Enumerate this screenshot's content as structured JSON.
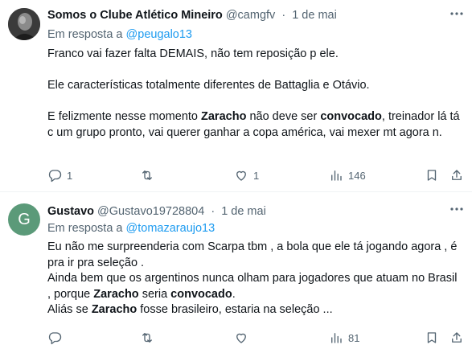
{
  "tweets": [
    {
      "author_name": "Somos o Clube Atlético Mineiro",
      "handle": "@camgfv",
      "separator": "·",
      "date": "1 de mai",
      "reply_prefix": "Em resposta a",
      "reply_to": "@peugalo13",
      "lines": {
        "p1": "Franco vai fazer falta DEMAIS, não tem reposição p ele.",
        "p2": "Ele características totalmente diferentes de Battaglia e Otávio.",
        "p3_a": "E felizmente nesse momento ",
        "p3_b": "Zaracho",
        "p3_c": " não deve ser ",
        "p3_d": "convocado",
        "p3_e": ", treinador lá tá c um grupo pronto, vai querer ganhar a copa américa, vai mexer mt agora n."
      },
      "replies": "1",
      "reposts": "",
      "likes": "1",
      "views": "146"
    },
    {
      "author_name": "Gustavo",
      "avatar_letter": "G",
      "handle": "@Gustavo19728804",
      "separator": "·",
      "date": "1 de mai",
      "reply_prefix": "Em resposta a",
      "reply_to": "@tomazaraujo13",
      "lines": {
        "l1": "Eu não me surpreenderia com Scarpa tbm , a bola que ele tá jogando agora , é pra ir pra seleção .",
        "l2": "Ainda bem que os argentinos nunca olham para jogadores que atuam no Brasil , porque ",
        "l2_b": "Zaracho",
        "l2_c": " seria ",
        "l2_d": "convocado",
        "l2_e": ".",
        "l3_a": "Aliás se ",
        "l3_b": "Zaracho",
        "l3_c": " fosse brasileiro, estaria na seleção ..."
      },
      "replies": "",
      "reposts": "",
      "likes": "",
      "views": "81"
    }
  ],
  "colors": {
    "text": "#0f1419",
    "muted": "#536471",
    "accent": "#1d9bf0",
    "avatar_g": "#5b9a79"
  },
  "icons": [
    "reply-icon",
    "repost-icon",
    "like-icon",
    "views-icon",
    "bookmark-icon",
    "share-icon",
    "more-icon"
  ]
}
